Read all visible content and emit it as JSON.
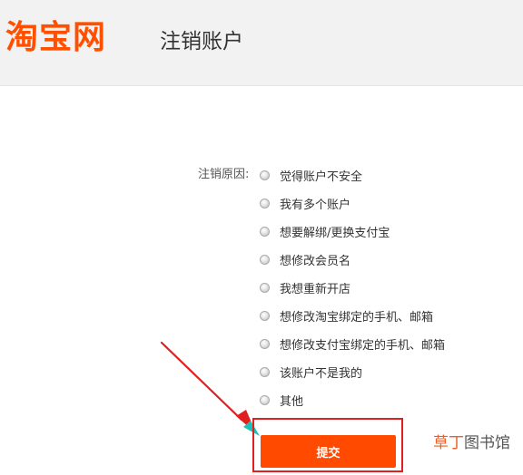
{
  "header": {
    "logo_text": "淘宝网",
    "title": "注销账户"
  },
  "form": {
    "reason_label": "注销原因:",
    "options": [
      {
        "label": "觉得账户不安全",
        "selected": false
      },
      {
        "label": "我有多个账户",
        "selected": false
      },
      {
        "label": "想要解绑/更换支付宝",
        "selected": false
      },
      {
        "label": "想修改会员名",
        "selected": false
      },
      {
        "label": "我想重新开店",
        "selected": false
      },
      {
        "label": "想修改淘宝绑定的手机、邮箱",
        "selected": false
      },
      {
        "label": "想修改支付宝绑定的手机、邮箱",
        "selected": false
      },
      {
        "label": "该账户不是我的",
        "selected": false
      },
      {
        "label": "其他",
        "selected": false
      }
    ],
    "submit_label": "提交"
  },
  "watermark": {
    "accent_text": "草丁",
    "rest_text": "图书馆"
  },
  "colors": {
    "brand": "#ff5000",
    "button": "#ff4a00",
    "highlight_box": "#e02020",
    "arrow": "#e02020"
  }
}
